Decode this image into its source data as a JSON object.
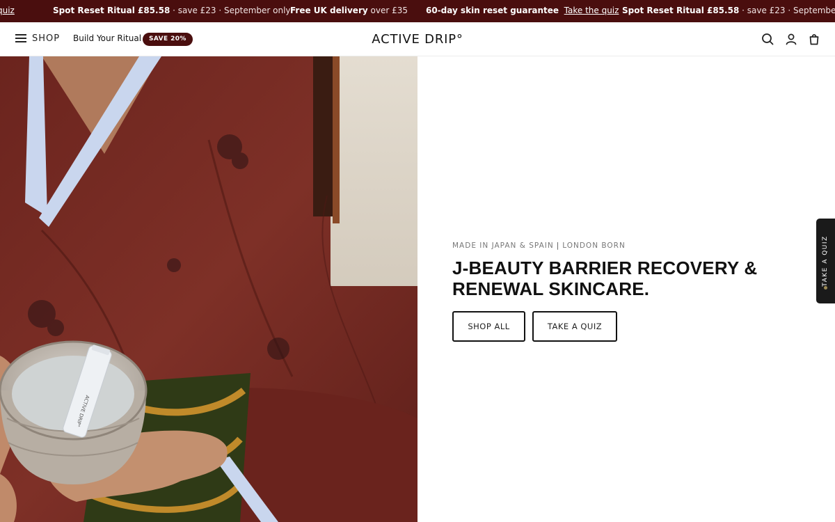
{
  "announcement": {
    "items": [
      {
        "bold": "",
        "rest": "",
        "link": "quiz"
      },
      {
        "bold": "Spot Reset Ritual £85.58",
        "rest": " · save £23 · September only",
        "link": ""
      },
      {
        "bold": "Free UK delivery",
        "rest": " over £35",
        "link": ""
      },
      {
        "bold": "60-day skin reset guarantee",
        "rest": "  ",
        "link": "Take the quiz"
      },
      {
        "bold": "Spot Reset Ritual £85.58",
        "rest": " · save £23 · September only",
        "link": ""
      }
    ]
  },
  "header": {
    "shop_label": "SHOP",
    "build_label": "Build Your Ritual",
    "save_badge": "SAVE 20%",
    "logo": "ACTIVE DRIP°",
    "icons": [
      "search-icon",
      "account-icon",
      "bag-icon"
    ]
  },
  "hero": {
    "eyebrow_left": "MADE IN JAPAN & SPAIN",
    "eyebrow_sep": "|",
    "eyebrow_right": "LONDON BORN",
    "headline": "J-BEAUTY BARRIER RECOVERY & RENEWAL SKINCARE.",
    "buttons": {
      "shop_all": "SHOP ALL",
      "take_quiz": "TAKE A QUIZ"
    },
    "product_text": "ACTIVE DRIP°"
  },
  "side_tab": {
    "label": "TAKE A QUIZ"
  },
  "colors": {
    "brand": "#4a0e0e",
    "kimono": "#7a2c24",
    "collar": "#c9d6ee",
    "text": "#111111",
    "side_tab": "#1a1a1a",
    "side_dot": "#9c8a55"
  }
}
